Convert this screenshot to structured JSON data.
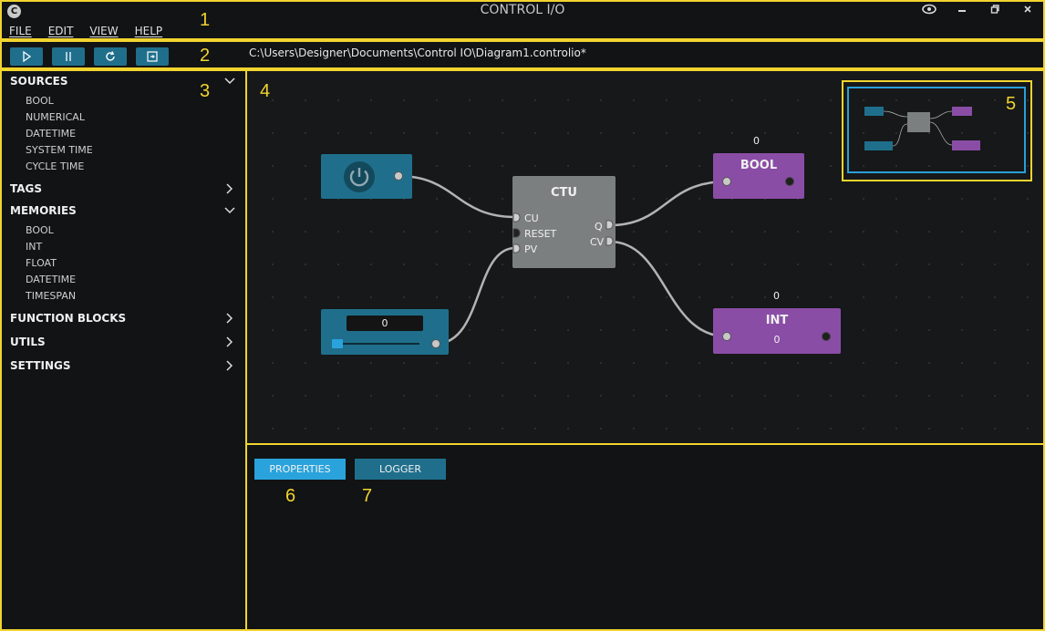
{
  "window": {
    "title": "CONTROL I/O",
    "logo": "C"
  },
  "menu": [
    "FILE",
    "EDIT",
    "VIEW",
    "HELP"
  ],
  "toolbar": {
    "file_path": "C:\\Users\\Designer\\Documents\\Control IO\\Diagram1.controlio*"
  },
  "sidebar": {
    "sources": {
      "label": "SOURCES",
      "items": [
        "BOOL",
        "NUMERICAL",
        "DATETIME",
        "SYSTEM TIME",
        "CYCLE TIME"
      ]
    },
    "tags": {
      "label": "TAGS"
    },
    "memories": {
      "label": "MEMORIES",
      "items": [
        "BOOL",
        "INT",
        "FLOAT",
        "DATETIME",
        "TIMESPAN"
      ]
    },
    "function_blocks": {
      "label": "FUNCTION BLOCKS"
    },
    "utils": {
      "label": "UTILS"
    },
    "settings": {
      "label": "SETTINGS"
    }
  },
  "diagram": {
    "ctu": {
      "title": "CTU",
      "inputs": [
        "CU",
        "RESET",
        "PV"
      ],
      "outputs": [
        "Q",
        "CV"
      ]
    },
    "numeric_source": {
      "value": "0",
      "slider_level": 0
    },
    "bool_memory": {
      "title": "BOOL",
      "value_above": "0"
    },
    "int_memory": {
      "title": "INT",
      "value_above": "0",
      "value_inside": "0"
    }
  },
  "bottom_panel": {
    "tabs": [
      "PROPERTIES",
      "LOGGER"
    ],
    "active_tab": "PROPERTIES"
  },
  "callouts": [
    "1",
    "2",
    "3",
    "4",
    "5",
    "6",
    "7"
  ],
  "colors": {
    "accent_yellow": "#f2d42f",
    "source_blue": "#1f6f8c",
    "memory_purple": "#8a4da6",
    "block_gray": "#7b7f80",
    "active_tab": "#2aa3dc"
  }
}
